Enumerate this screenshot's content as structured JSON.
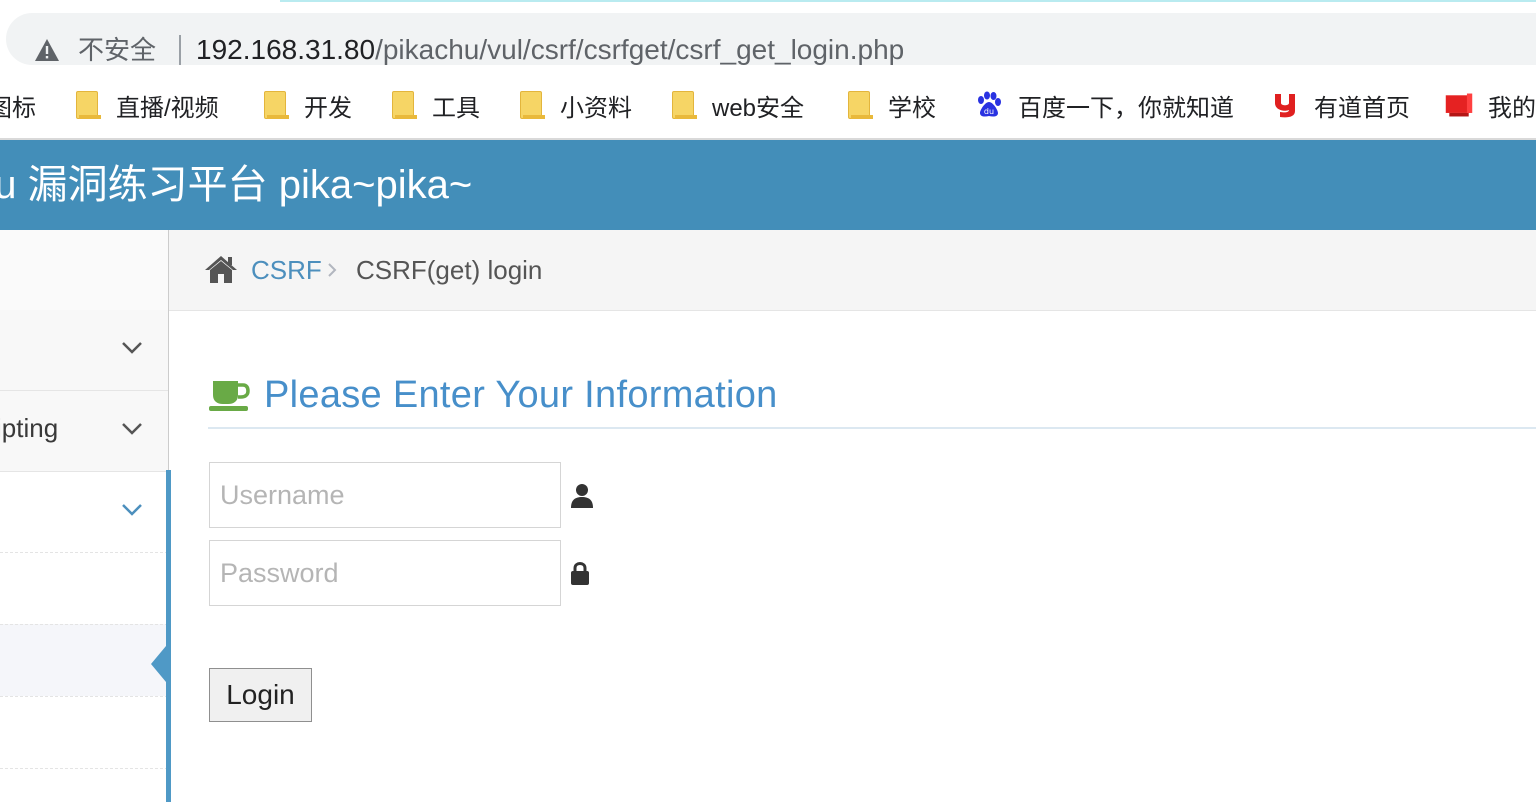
{
  "browser": {
    "security_label": "不安全",
    "url_host": "192.168.31.80",
    "url_path": "/pikachu/vul/csrf/csrfget/csrf_get_login.php"
  },
  "bookmarks": [
    {
      "label": "图标",
      "icon": "none"
    },
    {
      "label": "直播/视频",
      "icon": "folder-icon"
    },
    {
      "label": "开发",
      "icon": "folder-icon"
    },
    {
      "label": "工具",
      "icon": "folder-icon"
    },
    {
      "label": "小资料",
      "icon": "folder-icon"
    },
    {
      "label": "web安全",
      "icon": "folder-icon"
    },
    {
      "label": "学校",
      "icon": "folder-icon"
    },
    {
      "label": "百度一下，你就知道",
      "icon": "baidu-icon"
    },
    {
      "label": "有道首页",
      "icon": "youdao-icon"
    },
    {
      "label": "我的",
      "icon": "red-book-icon"
    }
  ],
  "header": {
    "title": "nu 漏洞练习平台 pika~pika~"
  },
  "sidebar": {
    "items": [
      {
        "label": ""
      },
      {
        "label": "ipting"
      },
      {
        "label": ""
      }
    ]
  },
  "breadcrumb": {
    "parent": "CSRF",
    "current": "CSRF(get) login"
  },
  "form": {
    "heading": "Please Enter Your Information",
    "username_placeholder": "Username",
    "password_placeholder": "Password",
    "username_value": "",
    "password_value": "",
    "login_label": "Login"
  },
  "colors": {
    "header_bg": "#438eb9",
    "link": "#4c8fbd",
    "heading": "#478fca",
    "coffee_icon": "#69aa46"
  }
}
